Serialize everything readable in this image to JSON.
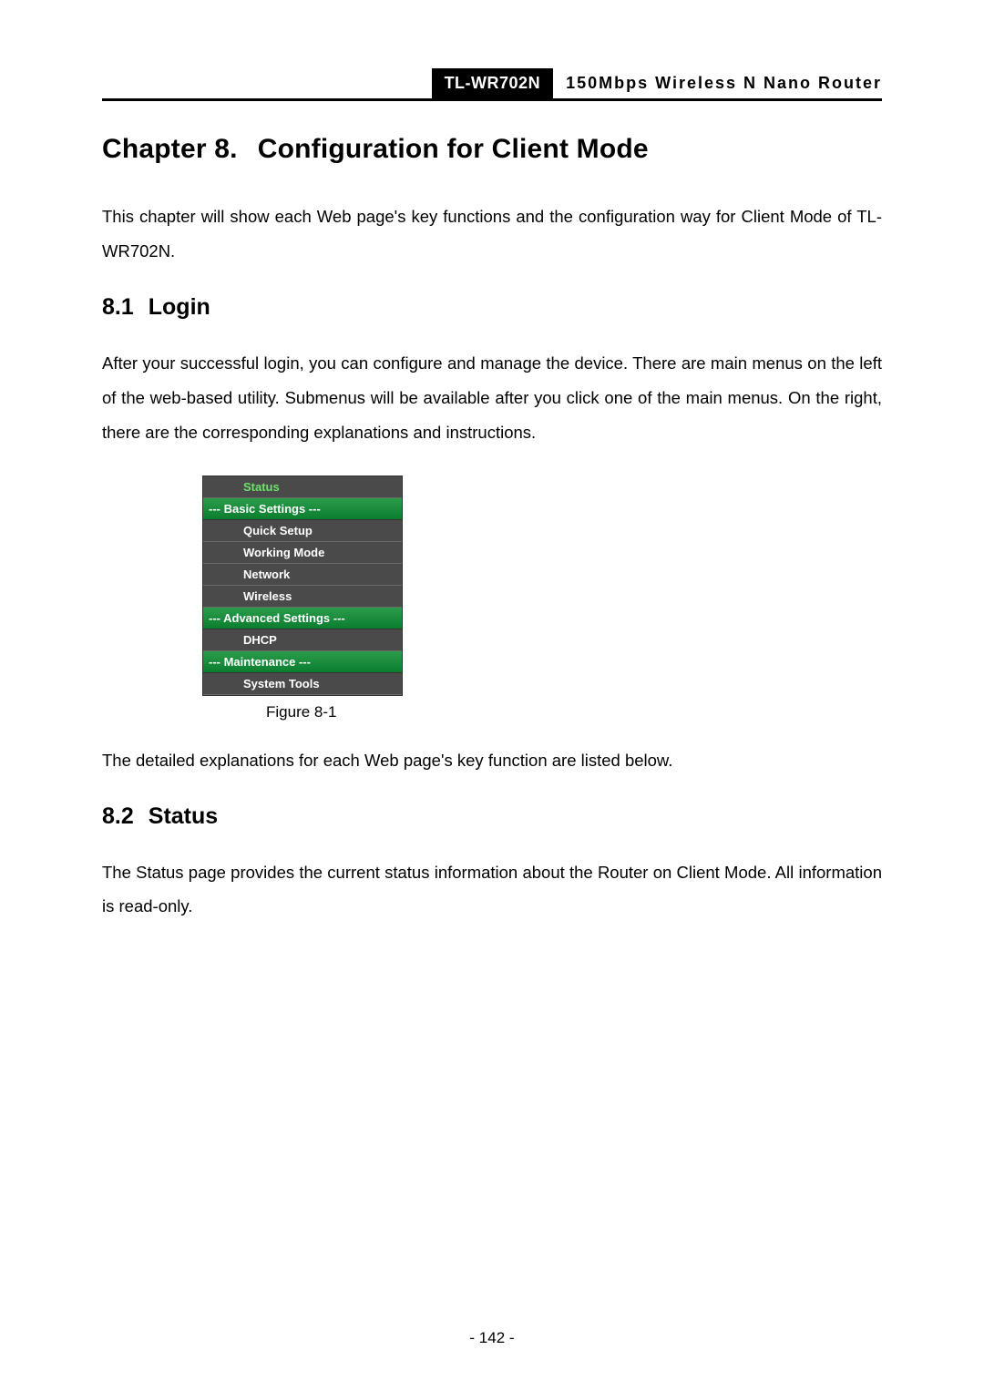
{
  "header": {
    "model": "TL-WR702N",
    "description": "150Mbps Wireless N Nano Router"
  },
  "chapter": {
    "number": "Chapter 8.",
    "title": "Configuration for Client Mode"
  },
  "intro_para": "This chapter will show each Web page's key functions and the configuration way for Client Mode of TL-WR702N.",
  "section_login": {
    "number": "8.1",
    "title": "Login",
    "para": "After your successful login, you can configure and manage the device. There are main menus on the left of the web-based utility. Submenus will be available after you click one of the main menus. On the right, there are the corresponding explanations and instructions."
  },
  "menu": {
    "status": "Status",
    "group_basic": "--- Basic Settings ---",
    "quick_setup": "Quick Setup",
    "working_mode": "Working Mode",
    "network": "Network",
    "wireless": "Wireless",
    "group_advanced": "--- Advanced Settings ---",
    "dhcp": "DHCP",
    "group_maintenance": "--- Maintenance ---",
    "system_tools": "System Tools"
  },
  "figure_caption": "Figure 8-1",
  "para_after_figure": "The detailed explanations for each Web page's key function are listed below.",
  "section_status": {
    "number": "8.2",
    "title": "Status",
    "para": "The Status page provides the current status information about the Router on Client Mode. All information is read-only."
  },
  "page_number": "- 142 -"
}
